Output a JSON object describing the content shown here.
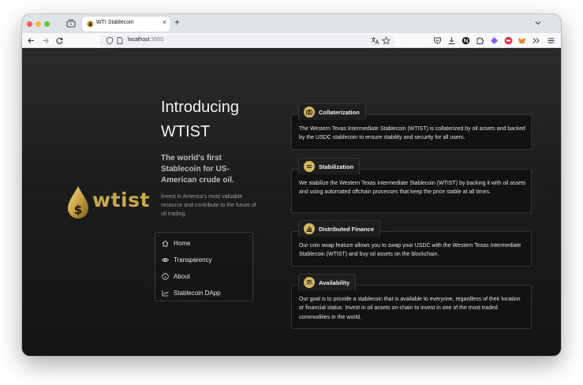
{
  "browser": {
    "tab_title": "WTI Stablecoin",
    "tab_close": "×",
    "new_tab": "+",
    "url_host": "localhost",
    "url_port": ":3500"
  },
  "logo": {
    "wordmark": "wtist",
    "drop_symbol": "$"
  },
  "hero": {
    "title": "Introducing WTIST",
    "subtitle": "The world's first Stablecoin for US-American crude oil.",
    "description": "Invest in America's most valuable resource and contribute to the future of oil trading."
  },
  "menu": {
    "items": [
      {
        "label": "Home",
        "icon": "home-icon"
      },
      {
        "label": "Transparency",
        "icon": "eye-icon"
      },
      {
        "label": "About",
        "icon": "info-icon"
      },
      {
        "label": "Stablecoin DApp",
        "icon": "chart-icon"
      }
    ]
  },
  "features": [
    {
      "title": "Collaterization",
      "icon": "camera-icon",
      "text": "The Western Texas Intermediate Stablecoin (WTIST) is collaterized by oil assets and backed by the USDC stablecoin to ensure stability and security for all users."
    },
    {
      "title": "Stabilization",
      "icon": "equals-icon",
      "text": "We stabilize the Western Texas Intermediate Stablecoin (WTIST) by backing it with oil assets and using automated offchain processes that keep the price stable at all times."
    },
    {
      "title": "Distributed Finance",
      "icon": "bars-icon",
      "text": "Our coin swap feature allows you to swap your USDC with the Western Texas Intermediate Stablecoin (WTIST) and buy oil assets on the blockchain."
    },
    {
      "title": "Availability",
      "icon": "users-icon",
      "text": "Our goal is to provide a stablecoin that is available to everyone, regardless of their location or financial status. Invest in oil assets on-chain to invest in one of the most traded commodities in the world."
    }
  ],
  "colors": {
    "gold": "#d4b661",
    "background": "#1b1b1b"
  }
}
